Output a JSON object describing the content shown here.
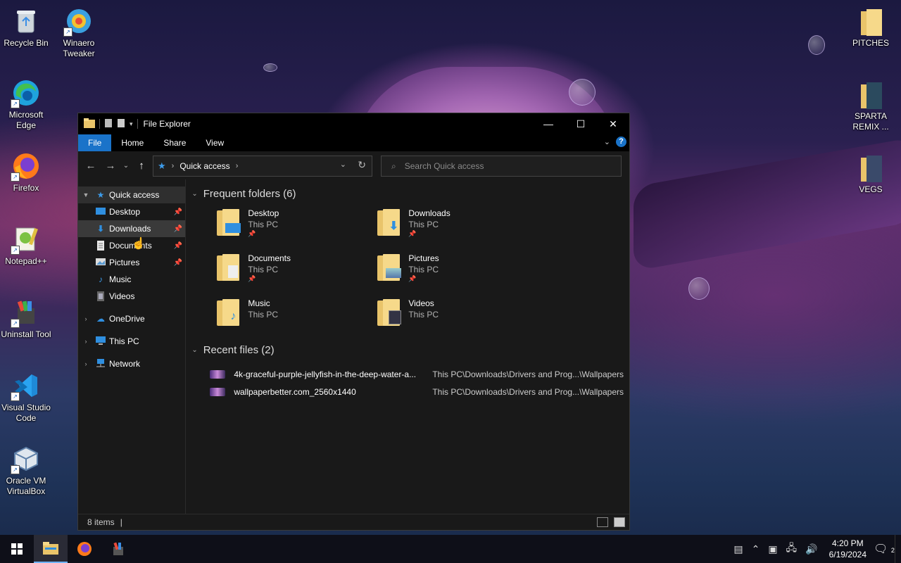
{
  "desktop": {
    "left_icons": [
      {
        "label": "Recycle Bin",
        "icon": "recycle-bin-icon"
      },
      {
        "label": "Winaero Tweaker",
        "icon": "winaero-tweaker-icon"
      },
      {
        "label": "Microsoft Edge",
        "icon": "edge-icon"
      },
      {
        "label": "Firefox",
        "icon": "firefox-icon"
      },
      {
        "label": "Notepad++",
        "icon": "notepadpp-icon"
      },
      {
        "label": "Uninstall Tool",
        "icon": "uninstall-tool-icon"
      },
      {
        "label": "Visual Studio Code",
        "icon": "vscode-icon"
      },
      {
        "label": "Oracle VM VirtualBox",
        "icon": "virtualbox-icon"
      }
    ],
    "right_icons": [
      {
        "label": "PITCHES",
        "icon": "folder-icon"
      },
      {
        "label": "SPARTA REMIX ...",
        "icon": "folder-icon"
      },
      {
        "label": "VEGS",
        "icon": "folder-icon"
      }
    ]
  },
  "explorer": {
    "title": "File Explorer",
    "ribbon_tabs": [
      "File",
      "Home",
      "Share",
      "View"
    ],
    "address": {
      "path": "Quick access"
    },
    "search": {
      "placeholder": "Search Quick access"
    },
    "nav": {
      "quick_access": "Quick access",
      "pinned": [
        {
          "label": "Desktop",
          "pinned": true
        },
        {
          "label": "Downloads",
          "pinned": true
        },
        {
          "label": "Documents",
          "pinned": true
        },
        {
          "label": "Pictures",
          "pinned": true
        },
        {
          "label": "Music",
          "pinned": false
        },
        {
          "label": "Videos",
          "pinned": false
        }
      ],
      "roots": [
        "OneDrive",
        "This PC",
        "Network"
      ]
    },
    "frequent": {
      "header": "Frequent folders (6)",
      "items": [
        {
          "name": "Desktop",
          "sub": "This PC",
          "pinned": true
        },
        {
          "name": "Downloads",
          "sub": "This PC",
          "pinned": true
        },
        {
          "name": "Documents",
          "sub": "This PC",
          "pinned": true
        },
        {
          "name": "Pictures",
          "sub": "This PC",
          "pinned": true
        },
        {
          "name": "Music",
          "sub": "This PC",
          "pinned": false
        },
        {
          "name": "Videos",
          "sub": "This PC",
          "pinned": false
        }
      ]
    },
    "recent": {
      "header": "Recent files (2)",
      "items": [
        {
          "name": "4k-graceful-purple-jellyfish-in-the-deep-water-a...",
          "location": "This PC\\Downloads\\Drivers and Prog...\\Wallpapers"
        },
        {
          "name": "wallpaperbetter.com_2560x1440",
          "location": "This PC\\Downloads\\Drivers and Prog...\\Wallpapers"
        }
      ]
    },
    "status": {
      "count": "8 items"
    }
  },
  "taskbar": {
    "time": "4:20 PM",
    "date": "6/19/2024",
    "notifications": "2"
  },
  "colors": {
    "accent": "#1a73c9",
    "window_bg": "#191919",
    "taskbar": "#0e0f18"
  }
}
